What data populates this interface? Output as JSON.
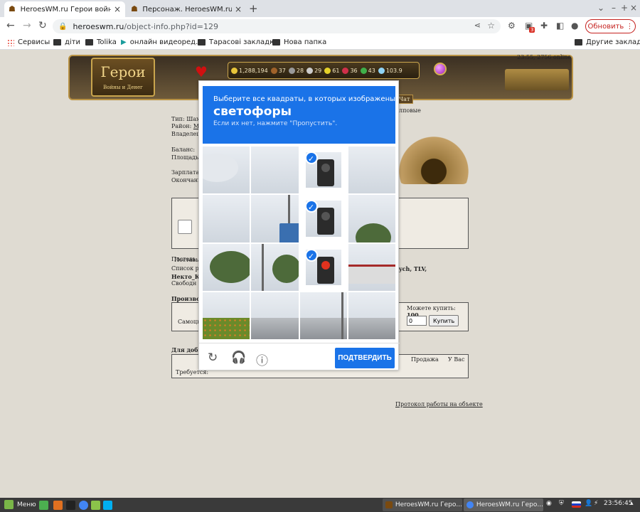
{
  "browser": {
    "tabs": [
      {
        "title": "HeroesWM.ru Герои войны и Де"
      },
      {
        "title": "Персонаж. HeroesWM.ru Герои"
      }
    ],
    "url_host": "heroeswm.ru",
    "url_path": "/object-info.php?id=129",
    "update_label": "Обновить",
    "ext_badge": "3",
    "bookmarks": [
      "Сервисы",
      "діти",
      "Tolika",
      "онлайн видеоред...",
      "Тарасові закладки",
      "Нова папка"
    ],
    "other_bookmarks": "Другие закладки"
  },
  "header": {
    "logo_text": "Герои",
    "logo_sub": "Войны и Денег",
    "resources": [
      "1,288,194",
      "37",
      "28",
      "29",
      "61",
      "36",
      "43",
      "103.9"
    ],
    "online": "23:55, 2756 online",
    "nav_right": "Чат"
  },
  "info": {
    "type_label": "Тип: Шахт",
    "type_suffix": "лповые",
    "district": "Район:",
    "district_link": "Mi",
    "owner": "Владелец:",
    "balance": "Баланс:",
    "area": "Площадь:",
    "salary": "Зарплата:",
    "ending": "Окончани",
    "supply": "Поставь",
    "workers_list": "Список ра",
    "workers_tail": "ych, TLV,",
    "worker_bold": "Некто_К",
    "free": "Свободн",
    "production": "Произвол",
    "self": "Самоцве",
    "can_buy_label": "Можете купить:",
    "can_buy_value": "100",
    "qty_value": "0",
    "buy_label": "Купить",
    "for_mining": "Для добы",
    "sale_header": "Продажа",
    "you_have_header": "У Вас",
    "required": "Требуется:",
    "protocol": "Протокол работы на объекте"
  },
  "captcha": {
    "line1": "Выберите все квадраты, в которых изображены",
    "line2": "светофоры",
    "line3": "Если их нет, нажмите \"Пропустить\".",
    "confirm": "ПОДТВЕРДИТЬ",
    "selected_tiles": [
      2,
      6,
      10
    ]
  },
  "taskbar": {
    "menu": "Меню",
    "apps": [
      "HeroesWM.ru Геро...",
      "HeroesWM.ru Геро..."
    ],
    "clock": "23:56:45"
  }
}
